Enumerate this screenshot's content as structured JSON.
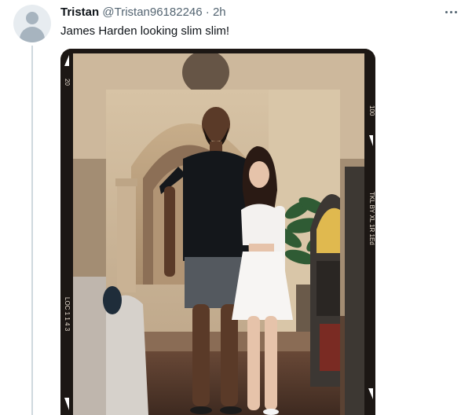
{
  "tweet": {
    "author_name": "Tristan",
    "author_handle": "@Tristan96182246",
    "separator": "·",
    "time": "2h",
    "text": "James Harden looking slim slim!"
  },
  "media": {
    "film_edge_labels": [
      "20",
      "LOC 1 1 4 3",
      "100",
      "TKL BY XL 1R 1Ed"
    ]
  },
  "icons": {
    "avatar": "default-avatar-icon",
    "more": "more-horizontal-icon"
  },
  "colors": {
    "text_primary": "#0f1419",
    "text_secondary": "#536471",
    "thread_line": "#cfd9de"
  }
}
